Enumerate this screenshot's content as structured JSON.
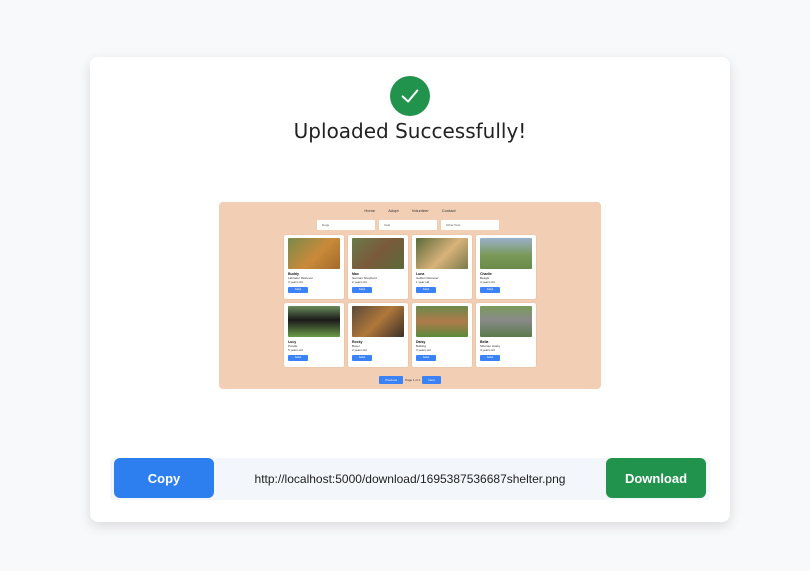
{
  "header": {
    "title": "Uploaded Successfully!",
    "status_icon": "check-circle-icon",
    "accent": "#21934c"
  },
  "preview": {
    "background": "#f2cfb4",
    "nav": [
      "Home",
      "Adopt",
      "Volunteer",
      "Contact"
    ],
    "filters": [
      "Dogs",
      "Cats",
      "Other Pets"
    ],
    "pets": [
      {
        "name": "Buddy",
        "breed": "Labrador Retriever",
        "age": "3 years old",
        "button": "Adopt"
      },
      {
        "name": "Max",
        "breed": "German Shepherd",
        "age": "2 years old",
        "button": "Adopt"
      },
      {
        "name": "Luna",
        "breed": "Golden Retriever",
        "age": "1 year old",
        "button": "Adopt"
      },
      {
        "name": "Charlie",
        "breed": "Beagle",
        "age": "4 years old",
        "button": "Adopt"
      },
      {
        "name": "Lucy",
        "breed": "Poodle",
        "age": "5 years old",
        "button": "Adopt"
      },
      {
        "name": "Rocky",
        "breed": "Boxer",
        "age": "2 years old",
        "button": "Adopt"
      },
      {
        "name": "Daisy",
        "breed": "Bulldog",
        "age": "3 years old",
        "button": "Adopt"
      },
      {
        "name": "Bella",
        "breed": "Siberian Husky",
        "age": "4 years old",
        "button": "Adopt"
      }
    ],
    "pager": {
      "prev": "Previous",
      "page": "Page 1 of 1",
      "next": "Next"
    }
  },
  "actions": {
    "copy_label": "Copy",
    "url": "http://localhost:5000/download/1695387536687shelter.png",
    "download_label": "Download",
    "copy_color": "#2d7ff0",
    "download_color": "#21934c"
  }
}
